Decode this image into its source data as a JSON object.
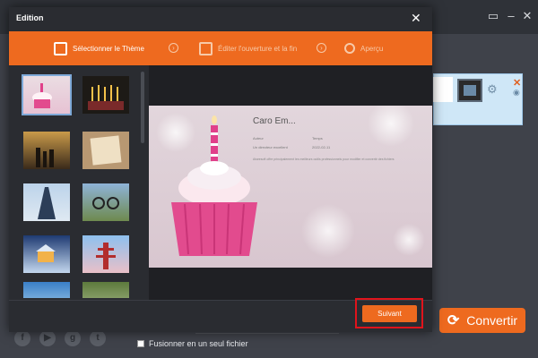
{
  "dialog": {
    "title": "Edition",
    "close_glyph": "✕"
  },
  "steps": [
    {
      "label": "Sélectionner le Thème",
      "icon": "theme-grid-icon",
      "active": true
    },
    {
      "label": "Éditer l'ouverture et la fin",
      "icon": "edit-icon",
      "active": false
    },
    {
      "label": "Aperçu",
      "icon": "search-icon",
      "active": false
    }
  ],
  "themes": [
    {
      "name": "birthday-cupcake-theme",
      "selected": true
    },
    {
      "name": "candles-theme",
      "selected": false
    },
    {
      "name": "sunset-family-theme",
      "selected": false
    },
    {
      "name": "vintage-paper-theme",
      "selected": false
    },
    {
      "name": "eiffel-tower-theme",
      "selected": false
    },
    {
      "name": "motocross-theme",
      "selected": false
    },
    {
      "name": "winter-cabin-theme",
      "selected": false
    },
    {
      "name": "pagoda-theme",
      "selected": false
    },
    {
      "name": "beach-theme",
      "selected": false
    },
    {
      "name": "horse-race-theme",
      "selected": false
    }
  ],
  "preview": {
    "title": "Caro Em...",
    "author_label": "Auteur",
    "author_value": "Un directeur excellent",
    "time_label": "Temps",
    "time_value": "2022-02-11",
    "description": "Aiseesoft offre principalement les meilleurs outils professionnels pour modifier et convertir des fichiers"
  },
  "next_button": "Suivant",
  "main": {
    "convert_button": "Convertir",
    "merge_label": "Fusionner en un seul fichier",
    "social_icons": [
      "facebook-icon",
      "youtube-icon",
      "google-plus-icon",
      "twitter-icon"
    ]
  },
  "colors": {
    "accent": "#ee6a1f",
    "highlight_border": "#e0141c",
    "selected_thumb": "#7ea9d8"
  }
}
